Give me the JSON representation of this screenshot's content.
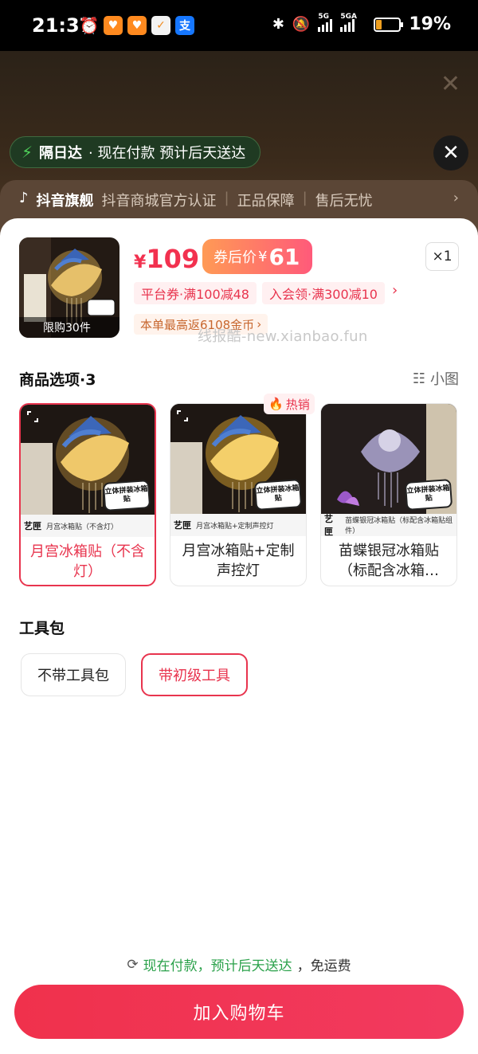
{
  "status_bar": {
    "time": "21:37",
    "battery": "19%",
    "network_1": "5G",
    "network_2": "5GA",
    "app_icons": [
      "alarm-icon",
      "taobao-app-icon",
      "taobao-app-icon",
      "huaxiao-app-icon",
      "alipay-app-icon"
    ]
  },
  "background": {
    "delivery_title": "隔日达",
    "delivery_text": "· 现在付款 预计后天送达",
    "store_badge": "抖音旗舰",
    "store_tags": [
      "抖音商城官方认证",
      "正品保障",
      "售后无忧"
    ]
  },
  "product": {
    "thumb_label": "限购30件",
    "price_currency": "¥",
    "price": "109",
    "coupon_price_label": "券后价",
    "coupon_price_currency": "¥",
    "coupon_price": "61",
    "quantity": "×1",
    "coupons": [
      "平台券·满100减48",
      "入会领·满300减10"
    ],
    "coin_rebate": "本单最高返6108金币",
    "watermark": "线报酷-new.xianbao.fun"
  },
  "options": {
    "title": "商品选项·3",
    "view_toggle": "小图",
    "hot_badge": "热销",
    "items": [
      {
        "label": "月宫冰箱贴（不含灯）",
        "strip_brand": "艺匣",
        "strip_text": "月宫冰箱贴（不含灯）",
        "sticker": "立体拼装冰箱贴",
        "selected": true
      },
      {
        "label": "月宫冰箱贴+定制声控灯",
        "strip_brand": "艺匣",
        "strip_text": "月宫冰箱贴+定制声控灯",
        "sticker": "立体拼装冰箱贴",
        "selected": false
      },
      {
        "label": "苗蝶银冠冰箱贴（标配含冰箱…",
        "strip_brand": "艺匣",
        "strip_text": "苗蝶银冠冰箱贴（标配含冰箱贴组件）",
        "sticker": "立体拼装冰箱贴",
        "selected": false
      }
    ]
  },
  "toolkit": {
    "title": "工具包",
    "items": [
      {
        "label": "不带工具包",
        "selected": false
      },
      {
        "label": "带初级工具",
        "selected": true
      }
    ]
  },
  "footer": {
    "ship_green": "现在付款，预计后天送达",
    "ship_rest": "，免运费",
    "add_to_cart": "加入购物车"
  },
  "colors": {
    "accent": "#f2314f",
    "coupon_gradient_start": "#ff9a55",
    "coupon_gradient_end": "#ff5a7a",
    "delivery_green": "#2aa14a"
  }
}
